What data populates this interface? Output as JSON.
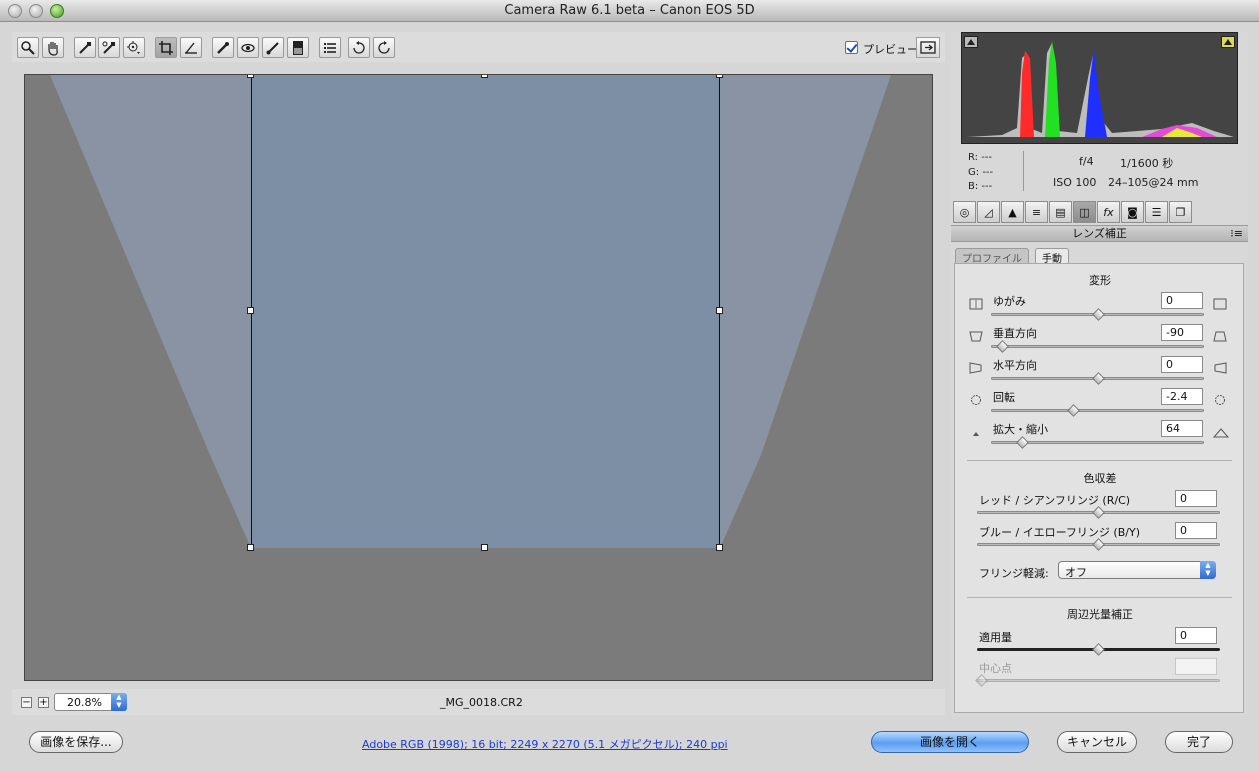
{
  "window": {
    "title": "Camera Raw 6.1 beta  –  Canon EOS 5D"
  },
  "toolbar": {
    "tools": [
      "zoom-icon",
      "hand-icon",
      "white-balance-icon",
      "color-sampler-icon",
      "target-adjust-icon",
      "crop-icon",
      "straighten-icon",
      "spot-removal-icon",
      "red-eye-icon",
      "adjustment-brush-icon",
      "graduated-filter-icon",
      "preferences-icon",
      "rotate-ccw-icon",
      "rotate-cw-icon"
    ],
    "preview_label": "プレビュー",
    "preview_checked": true
  },
  "status": {
    "zoom": "20.8%",
    "filename": "_MG_0018.CR2"
  },
  "info": {
    "r_label": "R:",
    "r_value": "---",
    "g_label": "G:",
    "g_value": "---",
    "b_label": "B:",
    "b_value": "---",
    "aperture": "f/4",
    "shutter": "1/1600 秒",
    "iso": "ISO 100",
    "lens": "24–105@24 mm"
  },
  "panel": {
    "section_title": "レンズ補正",
    "subtabs": [
      "プロファイル",
      "手動"
    ],
    "transform": {
      "title": "変形",
      "distortion_label": "ゆがみ",
      "distortion_value": "0",
      "vertical_label": "垂直方向",
      "vertical_value": "-90",
      "horizontal_label": "水平方向",
      "horizontal_value": "0",
      "rotate_label": "回転",
      "rotate_value": "-2.4",
      "scale_label": "拡大・縮小",
      "scale_value": "64"
    },
    "chromatic": {
      "title": "色収差",
      "rc_label": "レッド / シアンフリンジ (R/C)",
      "rc_value": "0",
      "by_label": "ブルー / イエローフリンジ (B/Y)",
      "by_value": "0",
      "defringe_label": "フリンジ軽減:",
      "defringe_value": "オフ"
    },
    "vignette": {
      "title": "周辺光量補正",
      "amount_label": "適用量",
      "amount_value": "0",
      "midpoint_label": "中心点",
      "midpoint_value": ""
    }
  },
  "footer": {
    "save_label": "画像を保存...",
    "workflow_link": "Adobe RGB (1998); 16 bit; 2249 x 2270 (5.1 メガピクセル); 240 ppi",
    "open_label": "画像を開く",
    "cancel_label": "キャンセル",
    "done_label": "完了"
  },
  "colors": {
    "accent": "#4f93ea",
    "canvas_bg": "#7b7b7b",
    "histogram_bg": "#444444"
  }
}
